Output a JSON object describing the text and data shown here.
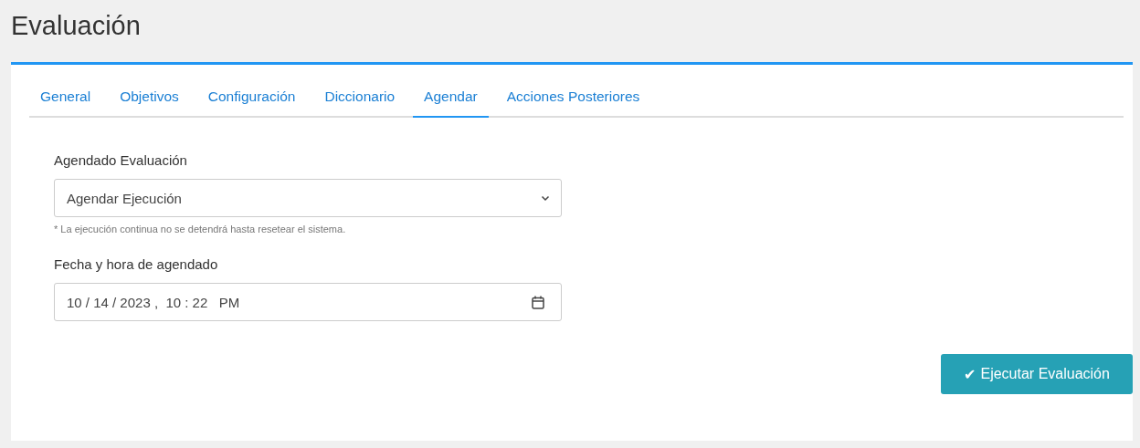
{
  "page": {
    "title": "Evaluación"
  },
  "tabs": [
    {
      "label": "General",
      "selected": false
    },
    {
      "label": "Objetivos",
      "selected": false
    },
    {
      "label": "Configuración",
      "selected": false
    },
    {
      "label": "Diccionario",
      "selected": false
    },
    {
      "label": "Agendar",
      "selected": true
    },
    {
      "label": "Acciones Posteriores",
      "selected": false
    }
  ],
  "schedule_field": {
    "label": "Agendado Evaluación",
    "value": "Agendar Ejecución",
    "help": "* La ejecución continua no se detendrá hasta resetear el sistema."
  },
  "datetime_field": {
    "label": "Fecha y hora de agendado",
    "value": "10 / 14 / 2023 ,  10 : 22   PM"
  },
  "buttons": [
    {
      "icon": "✔",
      "label": "Ejecutar Evaluación"
    }
  ]
}
